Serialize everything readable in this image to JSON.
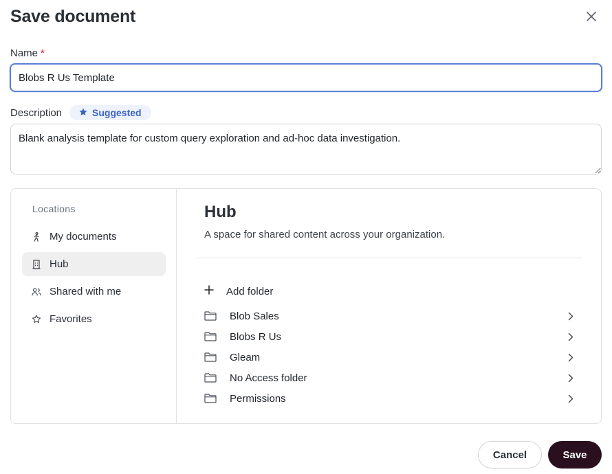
{
  "dialog": {
    "title": "Save document",
    "close_icon": "close-icon"
  },
  "name_field": {
    "label": "Name",
    "required_mark": "*",
    "value": "Blobs R Us Template"
  },
  "description_field": {
    "label": "Description",
    "badge_label": "Suggested",
    "badge_icon": "star-icon",
    "value": "Blank analysis template for custom query exploration and ad-hoc data investigation."
  },
  "sidebar": {
    "heading": "Locations",
    "items": [
      {
        "label": "My documents",
        "icon": "person-walking-icon",
        "active": false
      },
      {
        "label": "Hub",
        "icon": "building-icon",
        "active": true
      },
      {
        "label": "Shared with me",
        "icon": "users-icon",
        "active": false
      },
      {
        "label": "Favorites",
        "icon": "star-outline-icon",
        "active": false
      }
    ]
  },
  "main": {
    "title": "Hub",
    "subtitle": "A space for shared content across your organization.",
    "add_folder_label": "Add folder",
    "folders": [
      {
        "label": "Blob Sales"
      },
      {
        "label": "Blobs R Us"
      },
      {
        "label": "Gleam"
      },
      {
        "label": "No Access folder"
      },
      {
        "label": "Permissions"
      }
    ]
  },
  "footer": {
    "cancel_label": "Cancel",
    "save_label": "Save"
  },
  "colors": {
    "focus_border": "#5b7fd6",
    "badge_bg": "#eef2fb",
    "badge_text": "#3b64c8",
    "primary_button": "#2a0f1f",
    "active_item_bg": "#efefef"
  }
}
